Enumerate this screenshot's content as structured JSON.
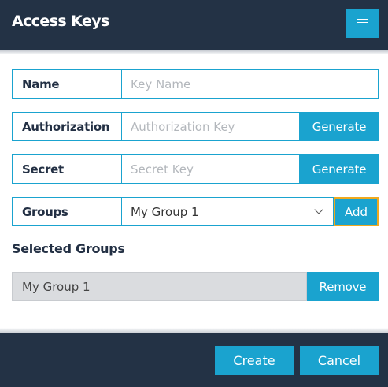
{
  "dialog": {
    "title": "Access Keys",
    "window_icon": "window-icon"
  },
  "form": {
    "name": {
      "label": "Name",
      "placeholder": "Key Name",
      "value": ""
    },
    "authorization": {
      "label": "Authorization",
      "placeholder": "Authorization Key",
      "value": "",
      "button": "Generate"
    },
    "secret": {
      "label": "Secret",
      "placeholder": "Secret Key",
      "value": "",
      "button": "Generate"
    },
    "groups": {
      "label": "Groups",
      "selected": "My Group 1",
      "button": "Add"
    }
  },
  "selected_groups": {
    "title": "Selected Groups",
    "items": [
      {
        "name": "My Group 1",
        "button": "Remove"
      }
    ]
  },
  "footer": {
    "create": "Create",
    "cancel": "Cancel"
  },
  "colors": {
    "header_bg": "#233245",
    "accent": "#1aa3cf",
    "focus_border": "#f0a91d",
    "selected_bg": "#dadcdf"
  }
}
